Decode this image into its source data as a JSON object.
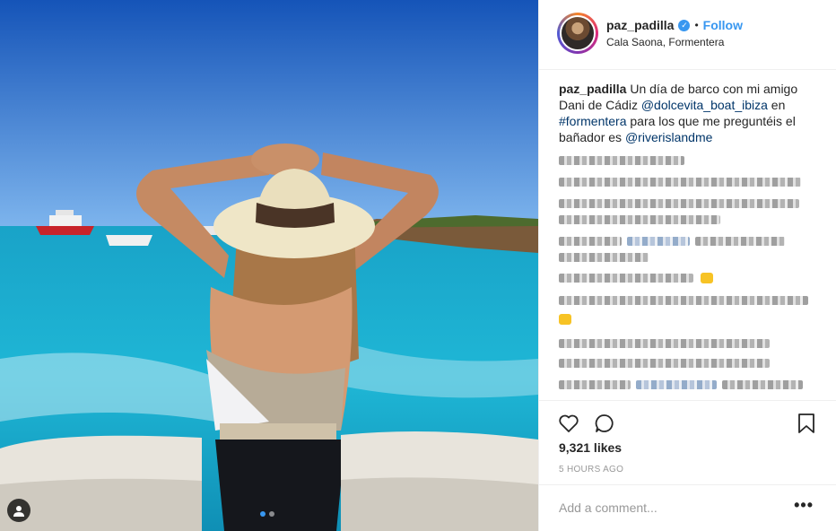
{
  "post": {
    "username": "paz_padilla",
    "follow_label": "Follow",
    "separator": "•",
    "location": "Cala Saona, Formentera"
  },
  "caption": {
    "username": "paz_padilla",
    "text_1": " Un día de barco con mi amigo Dani de Cádiz ",
    "mention_1": "@dolcevita_boat_ibiza",
    "text_2": " en ",
    "hashtag_1": "#formentera",
    "text_3": " para los que me preguntéis el bañador es ",
    "mention_2": "@riverislandme"
  },
  "engagement": {
    "likes": "9,321 likes",
    "time_ago": "5 HOURS AGO"
  },
  "comment_box": {
    "placeholder": "Add a comment..."
  },
  "more_options": "•••",
  "icons": {
    "like": "heart-icon",
    "comment": "comment-bubble-icon",
    "save": "bookmark-icon",
    "verified": "verified-badge-icon",
    "user_tags": "user-tag-icon"
  },
  "colors": {
    "accent": "#3897f0",
    "link": "#003569",
    "muted": "#999999"
  },
  "carousel": {
    "current": 1,
    "total": 2
  }
}
